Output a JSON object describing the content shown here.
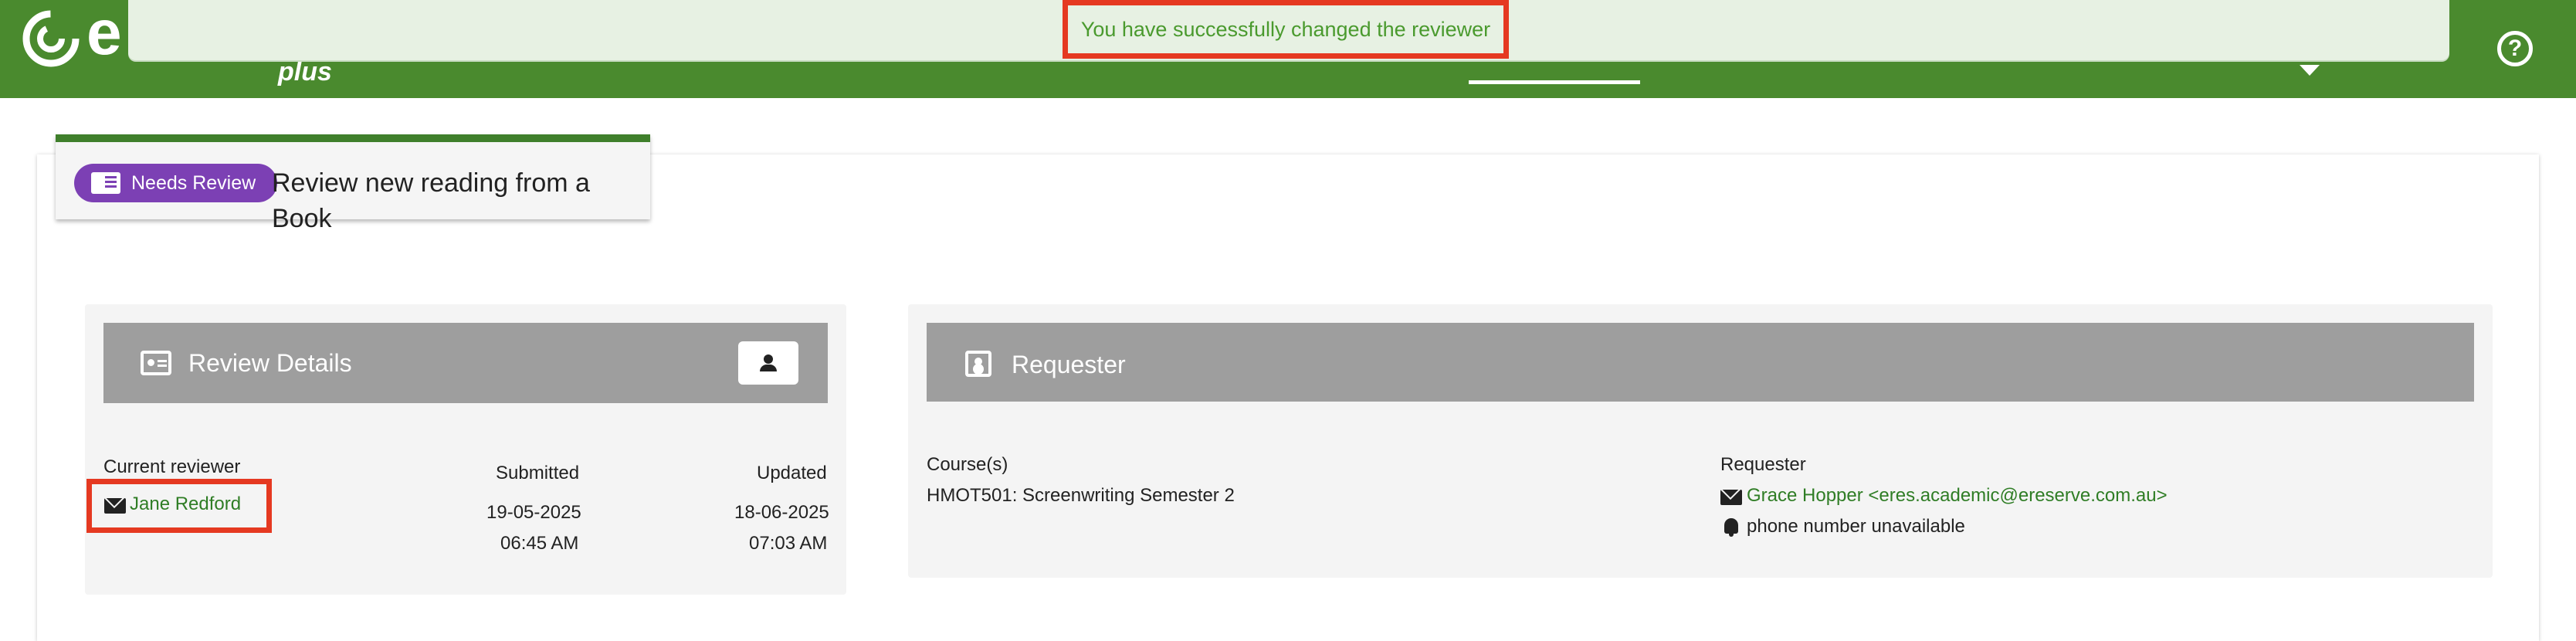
{
  "app": {
    "logo_text": "e",
    "sub_brand": "plus",
    "help_icon": "help-circle-icon"
  },
  "toast": {
    "message": "You have successfully changed the reviewer"
  },
  "page": {
    "badge_label": "Needs Review",
    "badge_icon": "book-icon",
    "title": "Review new reading from a Book"
  },
  "review_details": {
    "header": "Review Details",
    "current_reviewer_label": "Current reviewer",
    "current_reviewer_name": "Jane Redford",
    "submitted_label": "Submitted",
    "submitted_date": "19-05-2025",
    "submitted_time": "06:45 AM",
    "updated_label": "Updated",
    "updated_date": "18-06-2025",
    "updated_time": "07:03 AM"
  },
  "requester": {
    "header": "Requester",
    "courses_label": "Course(s)",
    "course": "HMOT501: Screenwriting Semester 2",
    "requester_label": "Requester",
    "requester_contact": "Grace Hopper <eres.academic@ereserve.com.au>",
    "phone": "phone number unavailable"
  },
  "colors": {
    "topbar": "#4a8a2e",
    "badge": "#7c40b4",
    "highlight": "#e53921",
    "link": "#2f7d25",
    "header_gray": "#9e9e9e"
  }
}
